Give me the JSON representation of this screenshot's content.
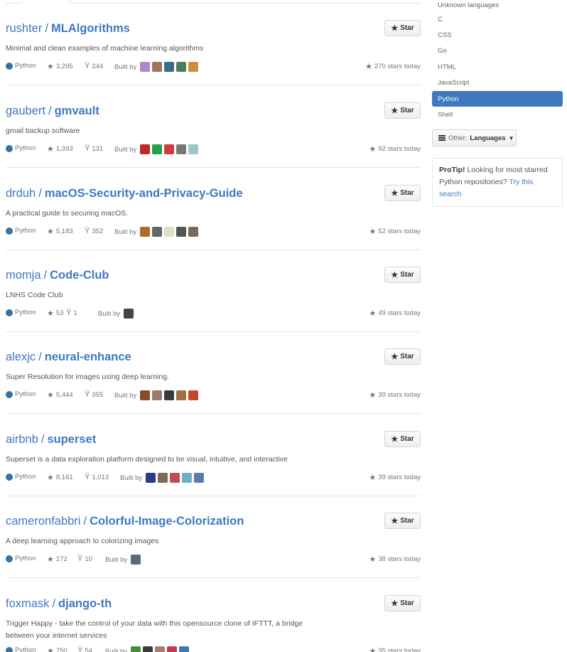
{
  "sidebar": {
    "languages": [
      "Unknown languages",
      "C",
      "CSS",
      "Go",
      "HTML",
      "JavaScript",
      "Python",
      "Shell"
    ],
    "selected": "Python",
    "other_prefix": "Other:",
    "other_label": "Languages",
    "protip": {
      "label": "ProTip!",
      "text": " Looking for most starred Python repositories? ",
      "link": "Try this search"
    }
  },
  "star_label": "Star",
  "built_by_label": "Built by",
  "repos": [
    {
      "owner": "rushter",
      "name": "MLAlgorithms",
      "description": "Minimal and clean examples of machine learning algorithms",
      "language": "Python",
      "stars": "3,295",
      "forks": "244",
      "today": "270 stars today",
      "contributors": [
        "#b388c9",
        "#a0765a",
        "#3b6b8a",
        "#4b7f5a",
        "#c9903e"
      ]
    },
    {
      "owner": "gaubert",
      "name": "gmvault",
      "description": "gmail backup software",
      "language": "Python",
      "stars": "1,393",
      "forks": "131",
      "today": "92 stars today",
      "contributors": [
        "#c0282d",
        "#26a04a",
        "#d43b3b",
        "#777777",
        "#9bc7c9"
      ]
    },
    {
      "owner": "drduh",
      "name": "macOS-Security-and-Privacy-Guide",
      "description": "A practical guide to securing macOS.",
      "language": "Python",
      "stars": "5,183",
      "forks": "352",
      "today": "52 stars today",
      "contributors": [
        "#b06a2e",
        "#666666",
        "#d8e4c0",
        "#555555",
        "#7a6a5a"
      ]
    },
    {
      "owner": "momja",
      "name": "Code-Club",
      "description": "LNHS Code Club",
      "language": "Python",
      "stars": "53",
      "forks": "1",
      "today": "49 stars today",
      "contributors": [
        "#444444"
      ]
    },
    {
      "owner": "alexjc",
      "name": "neural-enhance",
      "description": "Super Resolution for images using deep learning.",
      "language": "Python",
      "stars": "5,444",
      "forks": "355",
      "today": "39 stars today",
      "contributors": [
        "#8a4a2e",
        "#9a7a6a",
        "#3a3a3a",
        "#a0704a",
        "#c04a2a"
      ]
    },
    {
      "owner": "airbnb",
      "name": "superset",
      "description": "Superset is a data exploration platform designed to be visual, intuitive, and interactive",
      "language": "Python",
      "stars": "8,161",
      "forks": "1,013",
      "today": "39 stars today",
      "contributors": [
        "#2a3a8a",
        "#7a6a5a",
        "#c04a5a",
        "#6ab0c0",
        "#5a7ab0"
      ]
    },
    {
      "owner": "cameronfabbri",
      "name": "Colorful-Image-Colorization",
      "description": "A deep learning approach to colorizing images",
      "language": "Python",
      "stars": "172",
      "forks": "10",
      "today": "38 stars today",
      "contributors": [
        "#5a6a7a"
      ]
    },
    {
      "owner": "foxmask",
      "name": "django-th",
      "description": "Trigger Happy - take the control of your data with this opensource clone of IFTTT, a bridge between your internet services",
      "language": "Python",
      "stars": "750",
      "forks": "54",
      "today": "35 stars today",
      "contributors": [
        "#4a8a3a",
        "#3a3a3a",
        "#b07a6a",
        "#c03a4a",
        "#3a7ab0"
      ]
    }
  ]
}
